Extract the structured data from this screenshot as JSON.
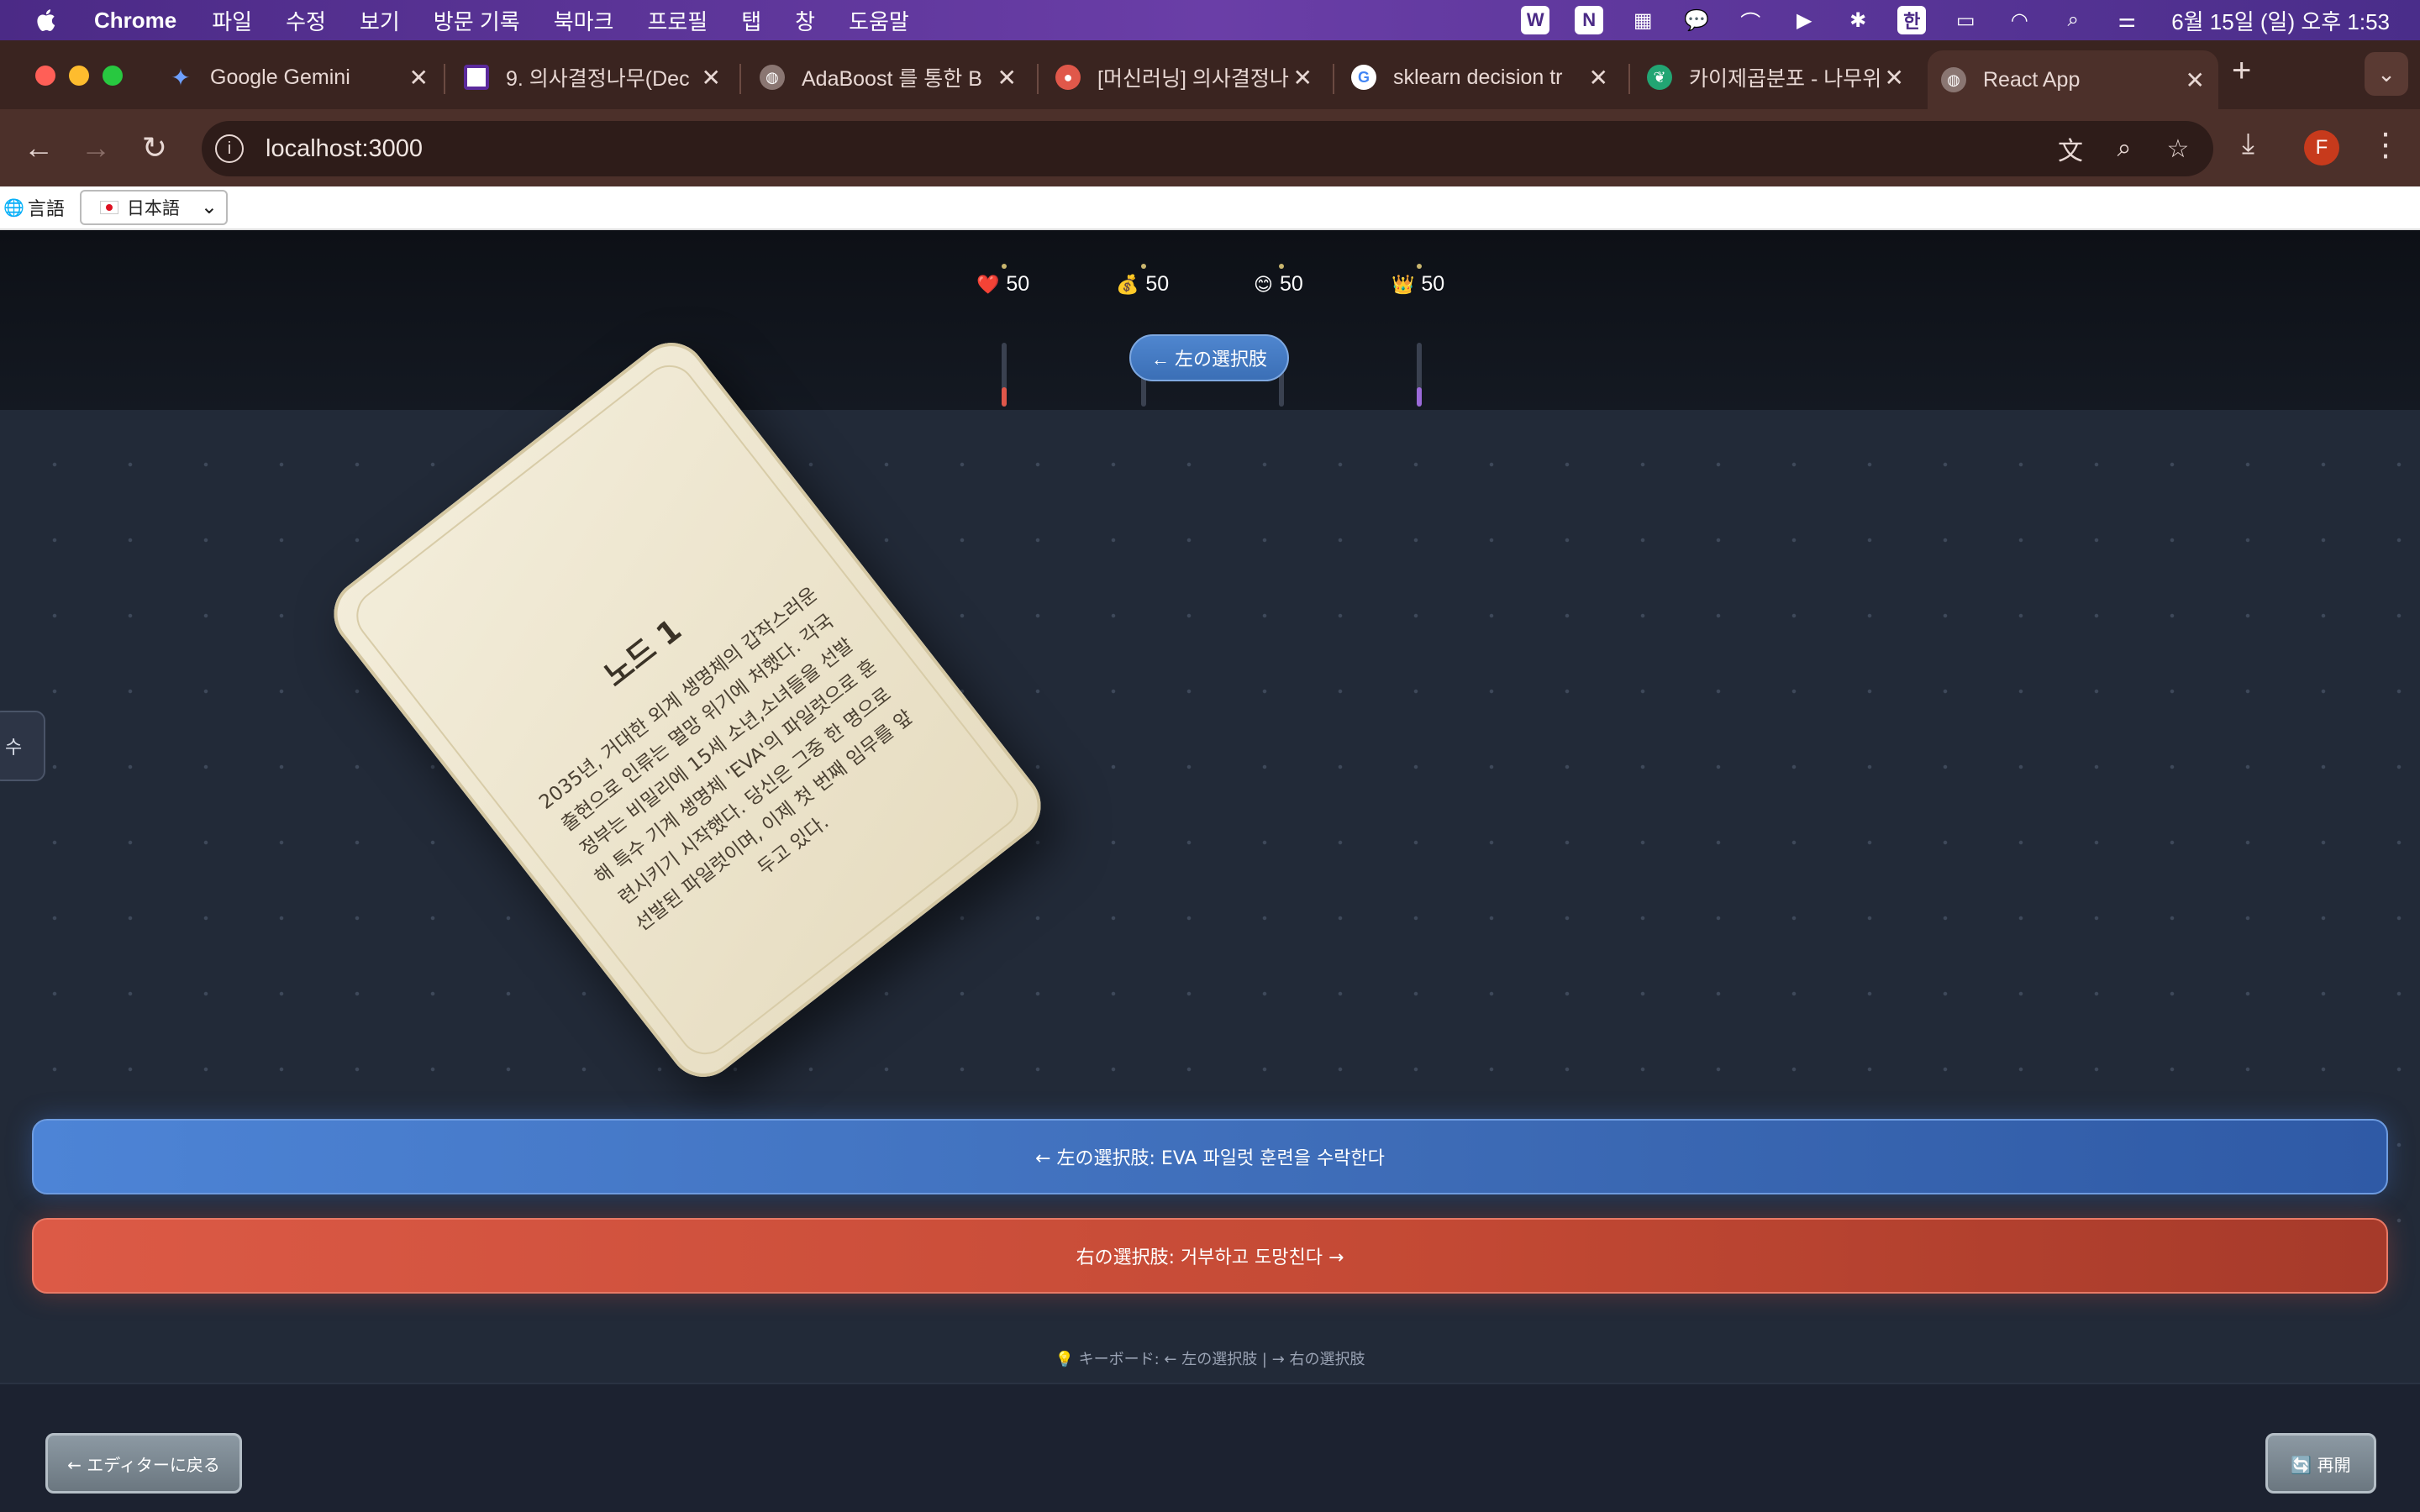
{
  "menubar": {
    "app_name": "Chrome",
    "items": [
      "파일",
      "수정",
      "보기",
      "방문 기록",
      "북마크",
      "프로필",
      "탭",
      "창",
      "도움말"
    ],
    "ime": "한",
    "clock": "6월 15일 (일) 오후 1:53"
  },
  "tabs": [
    {
      "title": "Google Gemini",
      "icon": "gemini-icon"
    },
    {
      "title": "9. 의사결정나무(Dec",
      "icon": "notebook-icon"
    },
    {
      "title": "AdaBoost 를 통한 B",
      "icon": "globe-icon"
    },
    {
      "title": "[머신러닝] 의사결정나",
      "icon": "blog-icon"
    },
    {
      "title": "sklearn decision tr",
      "icon": "google-icon"
    },
    {
      "title": "카이제곱분포 - 나무위",
      "icon": "namuwiki-icon"
    },
    {
      "title": "React App",
      "icon": "globe-icon",
      "active": true
    }
  ],
  "toolbar": {
    "url": "localhost:3000",
    "profile_initial": "F"
  },
  "language": {
    "label": "言語",
    "selected": "日本語"
  },
  "stats": [
    {
      "icon": "heart-icon",
      "emoji": "❤️",
      "value": "50",
      "fill_percent": 30,
      "color": "#e0574a"
    },
    {
      "icon": "money-bag-icon",
      "emoji": "💰",
      "value": "50",
      "fill_percent": 0,
      "color": "#d9b34a"
    },
    {
      "icon": "smile-icon",
      "emoji": "😊",
      "value": "50",
      "fill_percent": 0,
      "color": "#e0c24a"
    },
    {
      "icon": "crown-icon",
      "emoji": "👑",
      "value": "50",
      "fill_percent": 30,
      "color": "#9b6ad9"
    }
  ],
  "hint_pill": "← 左の選択肢",
  "side_tab": "수",
  "card": {
    "title": "노드 1",
    "text": "2035년, 거대한 외계 생명체의 갑작스러운 출현으로 인류는 멸망 위기에 처했다. 각국 정부는 비밀리에 15세 소년,소녀들을 선발해 특수 기계 생명체 'EVA'의 파일럿으로 훈련시키기 시작했다. 당신은 그중 한 명으로 선발된 파일럿이며, 이제 첫 번째 임무를 앞두고 있다."
  },
  "choices": {
    "left": "← 左の選択肢: EVA 파일럿 훈련을 수락한다",
    "right": "右の選択肢: 거부하고 도망친다 →"
  },
  "keyboard_hint": "💡 キーボード: ← 左の選択肢 | → 右の選択肢",
  "buttons": {
    "back": "← エディターに戻る",
    "restart": "🔄 再開"
  },
  "colors": {
    "left_choice": "#3d6bb6",
    "right_choice": "#c34934",
    "menubar": "#4b2a86",
    "chrome_frame": "#3a2420"
  }
}
